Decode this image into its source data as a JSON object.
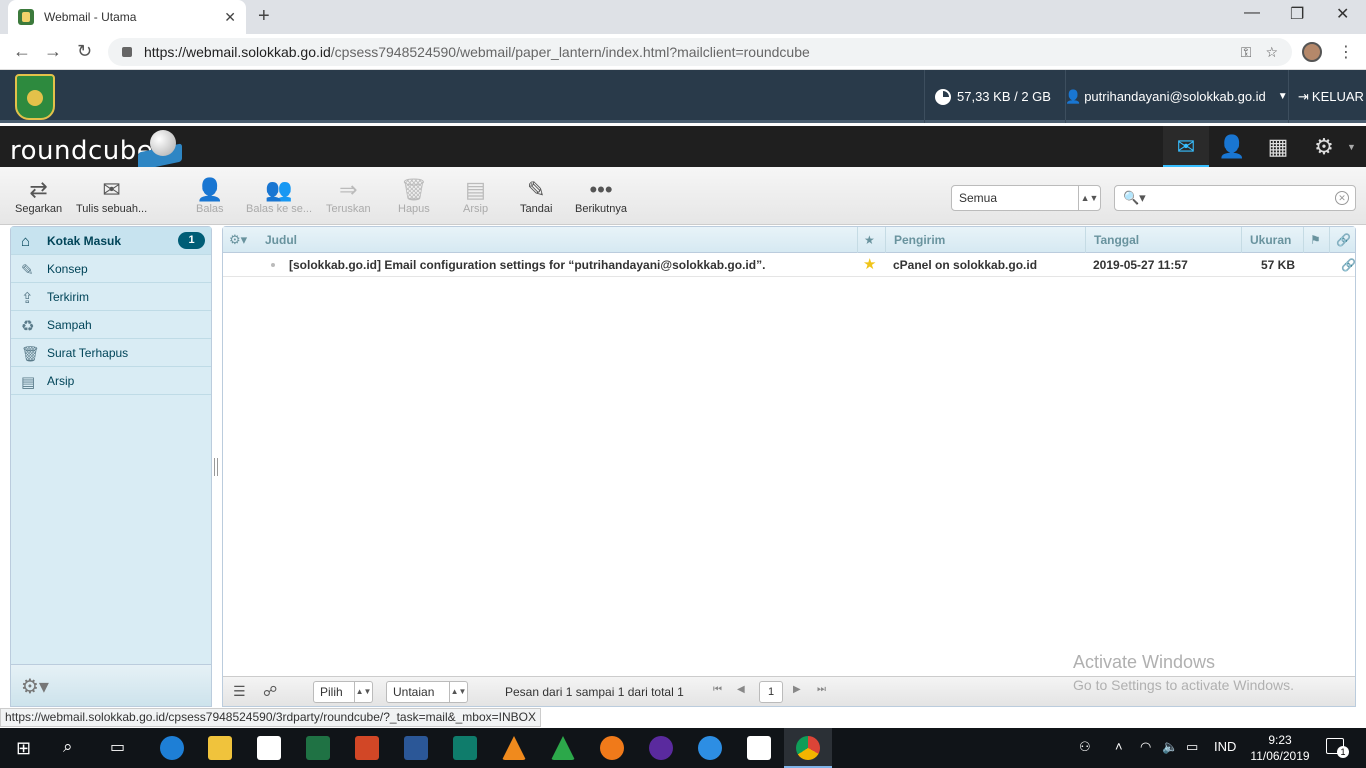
{
  "browser": {
    "tab_title": "Webmail - Utama",
    "url_domain": "https://webmail.solokkab.go.id",
    "url_path": "/cpsess7948524590/webmail/paper_lantern/index.html?mailclient=roundcube",
    "status_url": "https://webmail.solokkab.go.id/cpsess7948524590/3rdparty/roundcube/?_task=mail&_mbox=INBOX"
  },
  "cpanel": {
    "quota": "57,33 KB / 2 GB",
    "user": "putrihandayani@solokkab.go.id",
    "logout": "KELUAR"
  },
  "roundcube": {
    "logo_text": "roundcube"
  },
  "toolbar": {
    "refresh": "Segarkan",
    "compose": "Tulis sebuah...",
    "reply": "Balas",
    "reply_all": "Balas ke se...",
    "forward": "Teruskan",
    "delete": "Hapus",
    "archive": "Arsip",
    "mark": "Tandai",
    "more": "Berikutnya",
    "filter_value": "Semua",
    "search_placeholder": ""
  },
  "folders": [
    {
      "label": "Kotak Masuk",
      "unread": "1",
      "icon": "inbox-icon"
    },
    {
      "label": "Konsep",
      "icon": "pencil-icon"
    },
    {
      "label": "Terkirim",
      "icon": "sent-icon"
    },
    {
      "label": "Sampah",
      "icon": "junk-icon"
    },
    {
      "label": "Surat Terhapus",
      "icon": "trash-icon"
    },
    {
      "label": "Arsip",
      "icon": "archive-icon"
    }
  ],
  "list": {
    "columns": {
      "subject": "Judul",
      "from": "Pengirim",
      "date": "Tanggal",
      "size": "Ukuran"
    },
    "messages": [
      {
        "subject": "[solokkab.go.id] Email configuration settings for “putrihandayani@solokkab.go.id”.",
        "from": "cPanel on solokkab.go.id",
        "date": "2019-05-27 11:57",
        "size": "57 KB",
        "flagged": true,
        "attachment": true
      }
    ],
    "footer": {
      "select": "Pilih",
      "threads": "Untaian",
      "count": "Pesan dari 1 sampai 1 dari total 1",
      "page": "1"
    }
  },
  "watermark": {
    "line1": "Activate Windows",
    "line2": "Go to Settings to activate Windows."
  },
  "taskbar": {
    "lang": "IND",
    "time": "9:23",
    "date": "11/06/2019",
    "notifications": "1"
  },
  "colors": {
    "cpanel_header": "#293a4a",
    "roundcube_header": "#1f1f1f",
    "accent": "#37beff",
    "folder_bg": "#d9ecf4",
    "badge": "#005d76"
  }
}
